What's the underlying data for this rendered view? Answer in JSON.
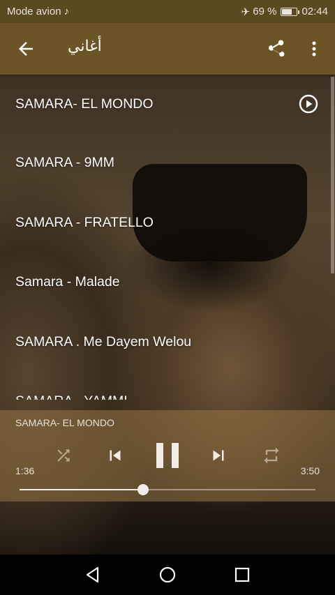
{
  "status_bar": {
    "carrier": "Mode avion",
    "battery_percent": "69 %",
    "time": "02:44"
  },
  "app_bar": {
    "title": "أغاني",
    "back_icon": "arrow-back-icon",
    "share_icon": "share-icon",
    "menu_icon": "more-vert-icon"
  },
  "songs": [
    {
      "title": "SAMARA- EL MONDO",
      "playing": true
    },
    {
      "title": "SAMARA - 9MM"
    },
    {
      "title": "SAMARA - FRATELLO"
    },
    {
      "title": "Samara - Malade"
    },
    {
      "title": "SAMARA . Me Dayem Welou"
    },
    {
      "title": "SAMARA - YAMMI"
    }
  ],
  "player": {
    "now_playing": "SAMARA- EL MONDO",
    "current_time": "1:36",
    "total_time": "3:50",
    "progress_fraction": 0.417,
    "shuffle_icon": "shuffle-icon",
    "prev_icon": "skip-previous-icon",
    "pause_icon": "pause-icon",
    "next_icon": "skip-next-icon",
    "repeat_icon": "repeat-icon"
  },
  "colors": {
    "status_bar": "#5a4a22",
    "app_bar": "#6b5526",
    "player_bg": "#96764699"
  }
}
